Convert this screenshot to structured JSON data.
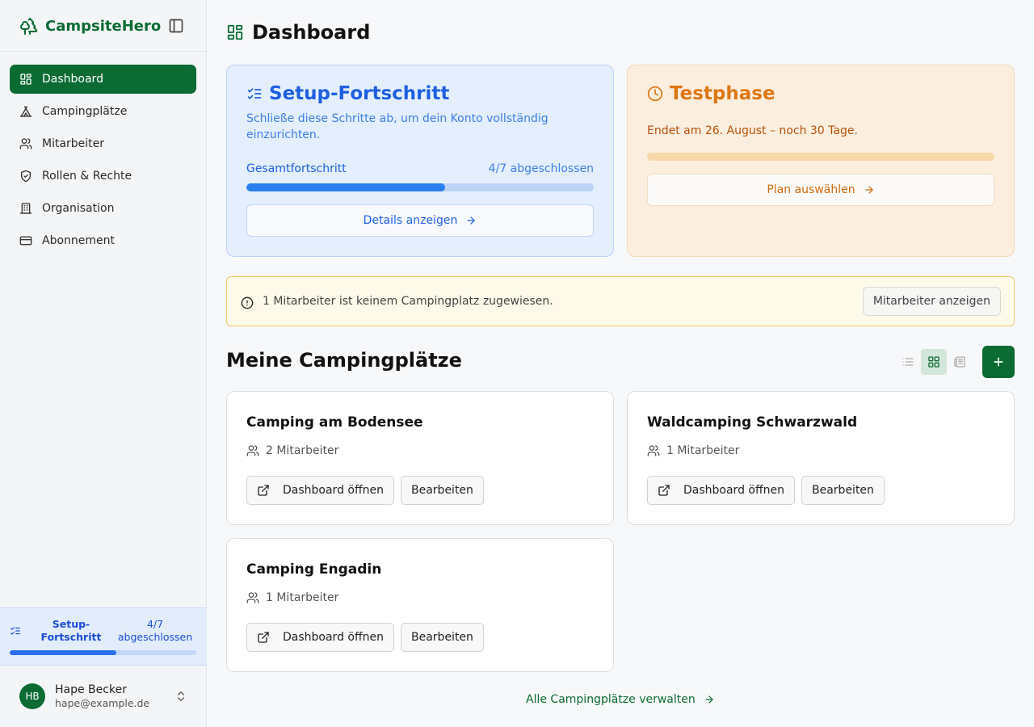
{
  "app": {
    "name": "CampsiteHero"
  },
  "sidebar": {
    "items": [
      {
        "label": "Dashboard",
        "icon": "dashboard-icon",
        "active": true
      },
      {
        "label": "Campingplätze",
        "icon": "tent-icon"
      },
      {
        "label": "Mitarbeiter",
        "icon": "users-icon"
      },
      {
        "label": "Rollen & Rechte",
        "icon": "shield-icon"
      },
      {
        "label": "Organisation",
        "icon": "building-icon"
      },
      {
        "label": "Abonnement",
        "icon": "credit-card-icon"
      }
    ],
    "progress": {
      "title": "Setup-Fortschritt",
      "count": "4/7 abgeschlossen",
      "fraction": 0.571
    },
    "user": {
      "initials": "HB",
      "name": "Hape Becker",
      "email": "hape@example.de"
    }
  },
  "main": {
    "title": "Dashboard",
    "setup": {
      "title": "Setup-Fortschritt",
      "description": "Schließe diese Schritte ab, um dein Konto vollständig einzurichten.",
      "progress_label": "Gesamtfortschritt",
      "progress_count": "4/7 abgeschlossen",
      "fraction": 0.571,
      "button": "Details anzeigen"
    },
    "trial": {
      "title": "Testphase",
      "description": "Endet am 26. August – noch 30 Tage.",
      "button": "Plan auswählen"
    },
    "alert": {
      "message": "1 Mitarbeiter ist keinem Campingplatz zugewiesen.",
      "button": "Mitarbeiter anzeigen"
    },
    "campsites": {
      "title": "Meine Campingplätze",
      "items": [
        {
          "name": "Camping am Bodensee",
          "staff": "2 Mitarbeiter",
          "open": "Dashboard öffnen",
          "edit": "Bearbeiten"
        },
        {
          "name": "Waldcamping Schwarzwald",
          "staff": "1 Mitarbeiter",
          "open": "Dashboard öffnen",
          "edit": "Bearbeiten"
        },
        {
          "name": "Camping Engadin",
          "staff": "1 Mitarbeiter",
          "open": "Dashboard öffnen",
          "edit": "Bearbeiten"
        }
      ],
      "manage_link": "Alle Campingplätze verwalten"
    }
  },
  "colors": {
    "brand": "#0b6b32",
    "setup": "#1d5fe0",
    "trial": "#e07612",
    "alert_border": "#ecc66a"
  }
}
